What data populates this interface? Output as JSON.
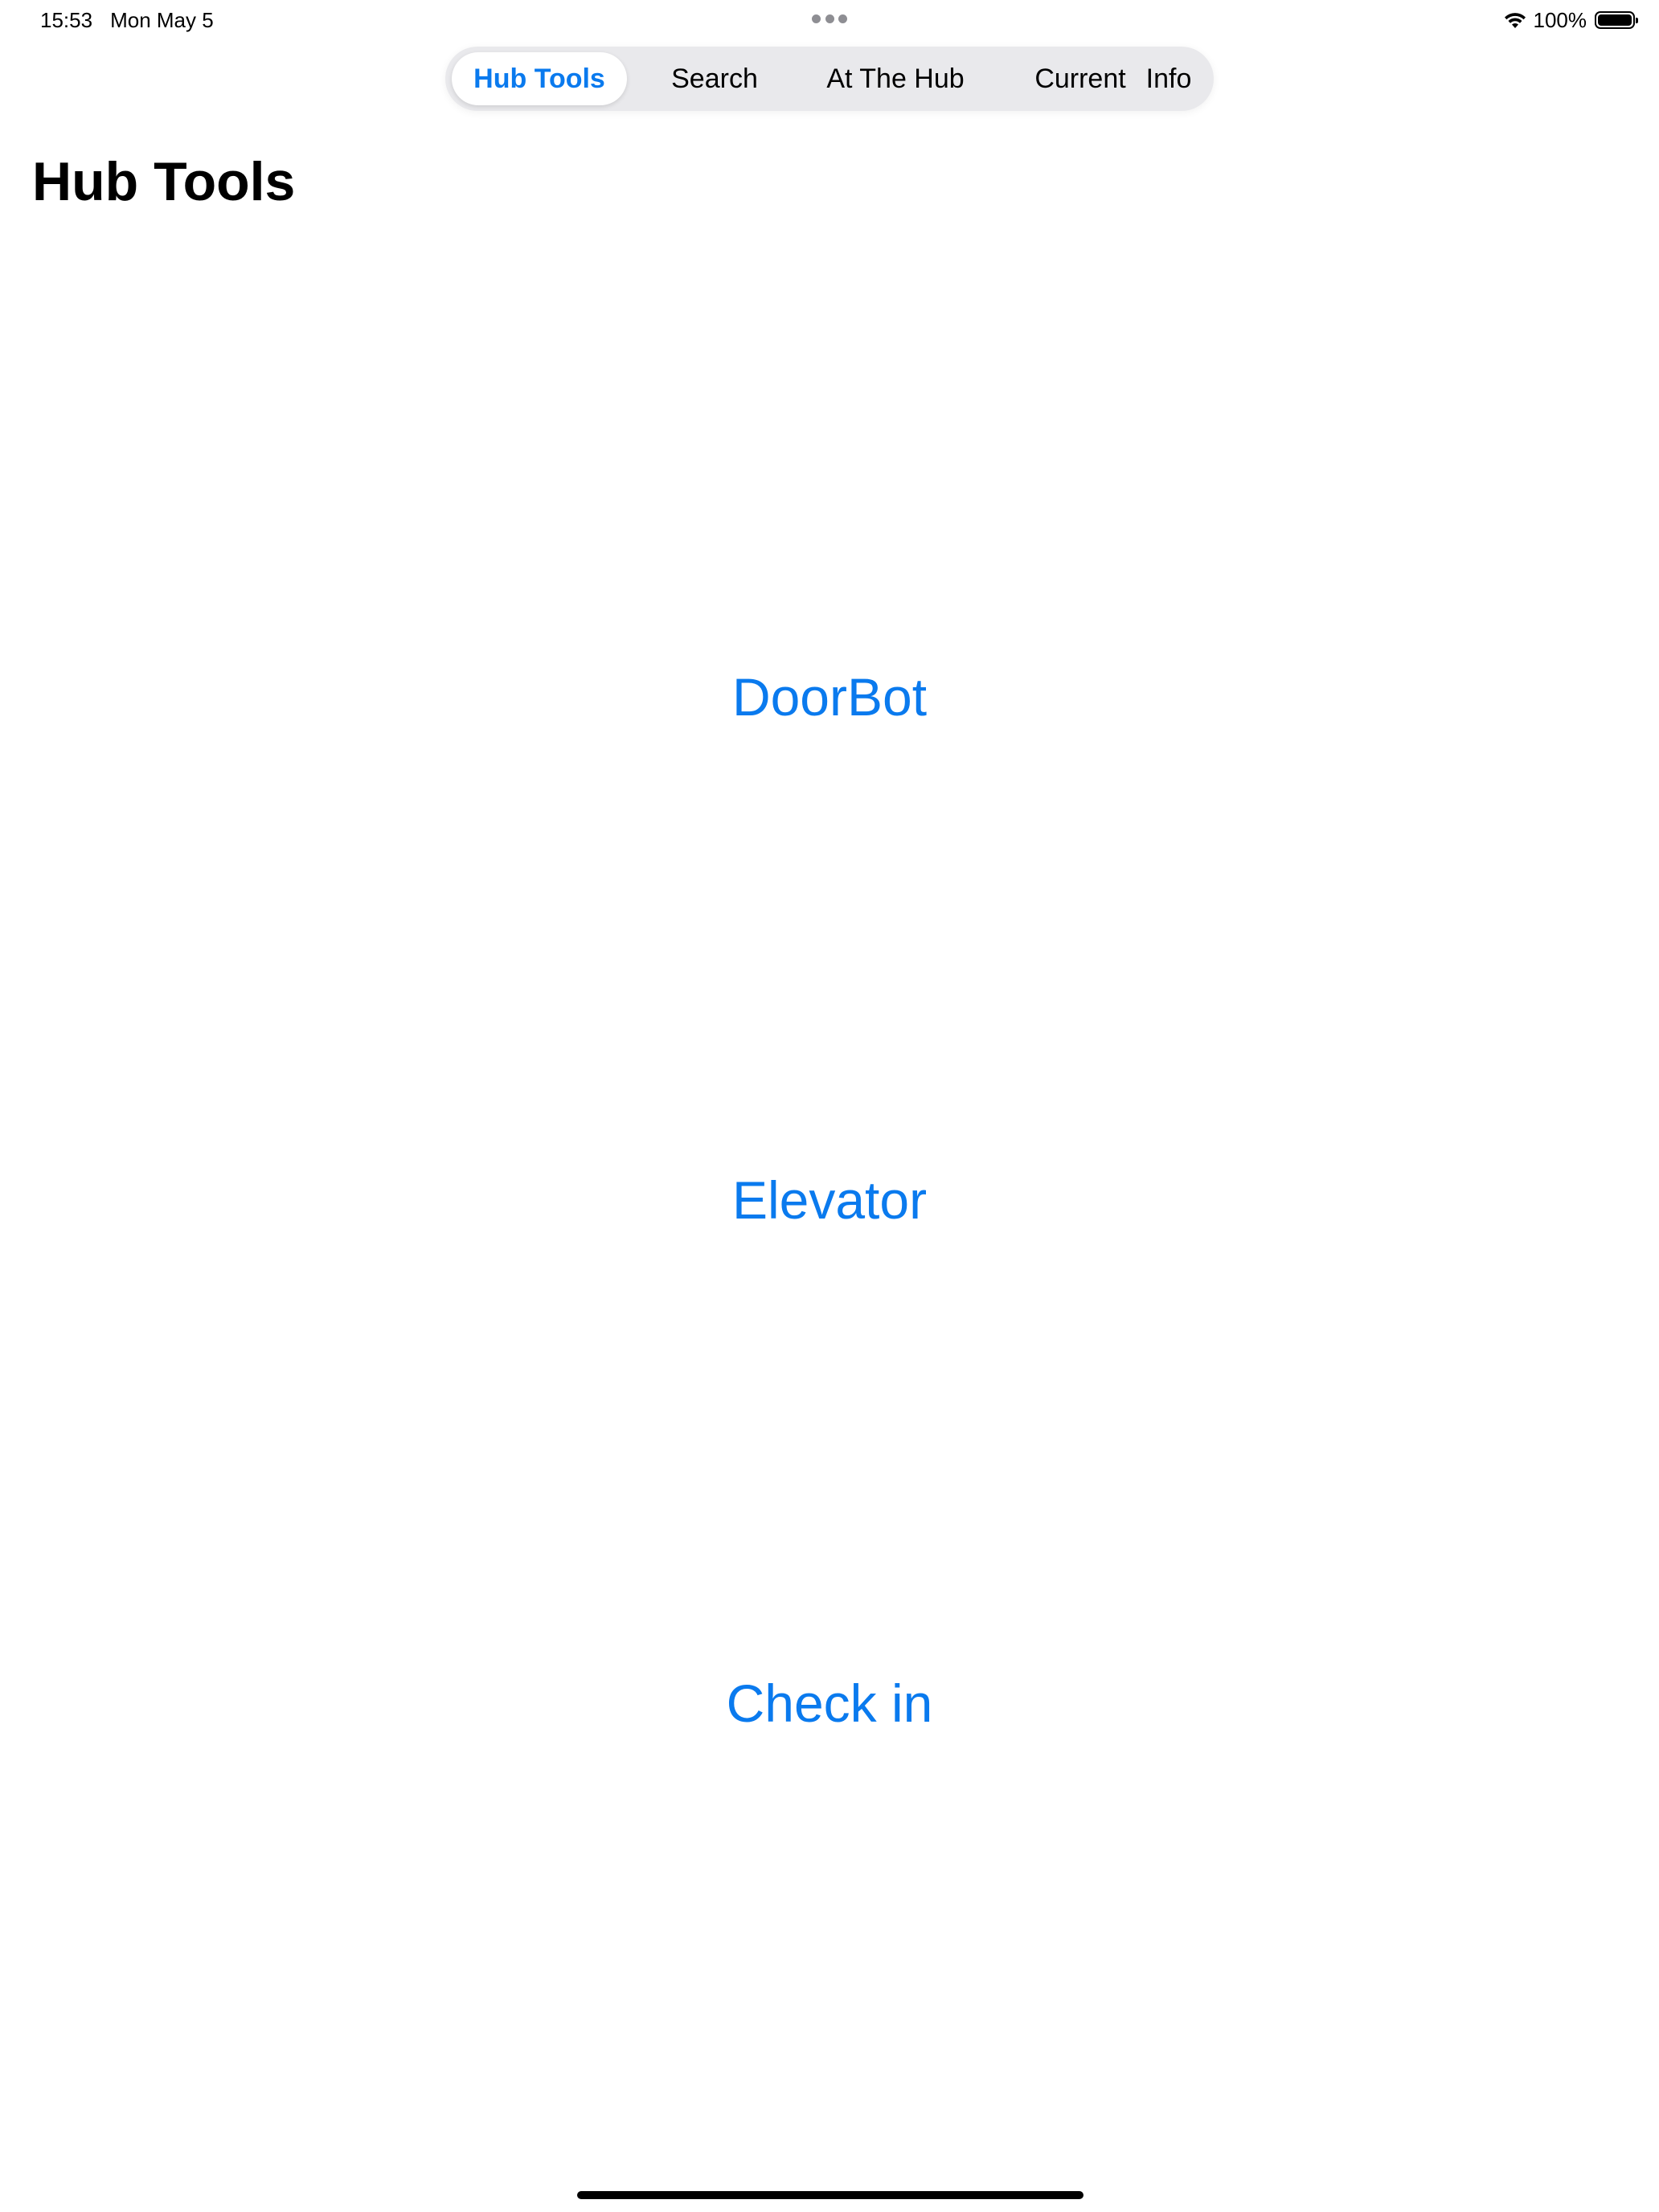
{
  "status_bar": {
    "time": "15:53",
    "date": "Mon May 5",
    "battery_percent": "100%",
    "wifi_icon": "wifi-icon",
    "battery_icon": "battery-full-icon",
    "multitask_icon": "more-dots-icon"
  },
  "tabs": [
    {
      "label": "Hub Tools",
      "selected": true
    },
    {
      "label": "Search",
      "selected": false
    },
    {
      "label": "At The Hub",
      "selected": false
    },
    {
      "label": "Current",
      "selected": false
    },
    {
      "label": "Info",
      "selected": false
    }
  ],
  "page": {
    "title": "Hub Tools"
  },
  "tools": [
    {
      "label": "DoorBot"
    },
    {
      "label": "Elevator"
    },
    {
      "label": "Check in"
    }
  ],
  "colors": {
    "accent": "#0a7aee",
    "tab_background": "#e9e9ec",
    "background": "#ffffff"
  }
}
